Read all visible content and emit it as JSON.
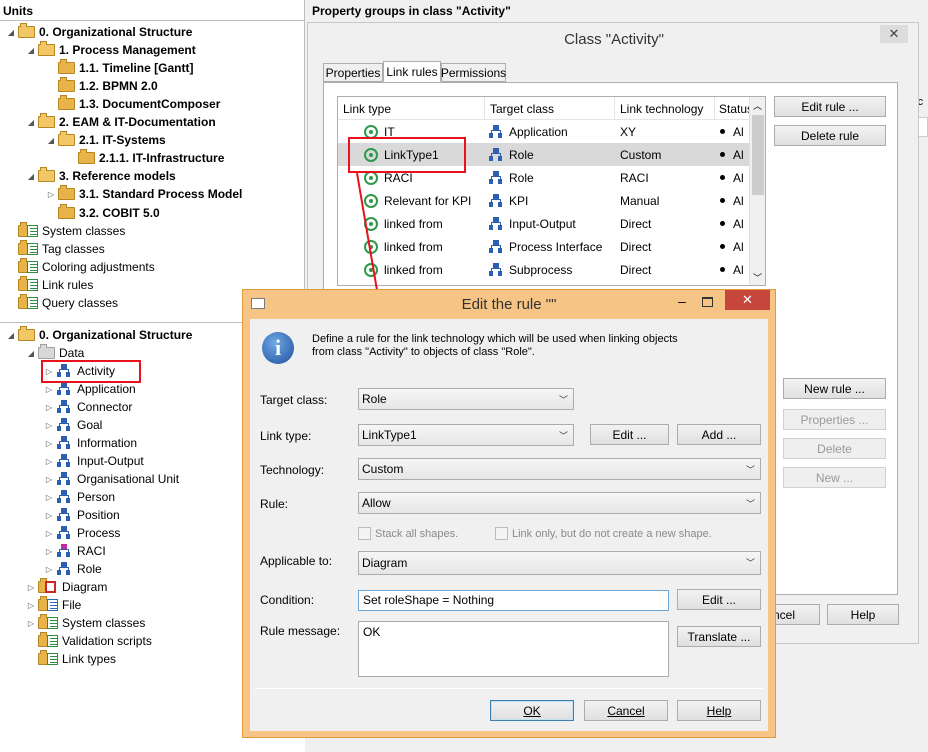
{
  "units_panel": {
    "title": "Units",
    "tree": [
      {
        "label": "0. Organizational Structure",
        "bold": true
      },
      {
        "label": "1. Process Management",
        "bold": true
      },
      {
        "label": "1.1. Timeline [Gantt]",
        "bold": true
      },
      {
        "label": "1.2. BPMN 2.0",
        "bold": true
      },
      {
        "label": "1.3. DocumentComposer",
        "bold": true
      },
      {
        "label": "2. EAM & IT-Documentation",
        "bold": true
      },
      {
        "label": "2.1. IT-Systems",
        "bold": true
      },
      {
        "label": "2.1.1. IT-Infrastructure",
        "bold": true
      },
      {
        "label": "3. Reference models",
        "bold": true
      },
      {
        "label": "3.1. Standard Process Model",
        "bold": true
      },
      {
        "label": "3.2. COBIT 5.0",
        "bold": true
      },
      {
        "label": "System classes"
      },
      {
        "label": "Tag classes"
      },
      {
        "label": "Coloring adjustments"
      },
      {
        "label": "Link rules"
      },
      {
        "label": "Query classes"
      }
    ]
  },
  "classes_panel": {
    "root": "0. Organizational Structure",
    "data": "Data",
    "classes": [
      "Activity",
      "Application",
      "Connector",
      "Goal",
      "Information",
      "Input-Output",
      "Organisational Unit",
      "Person",
      "Position",
      "Process",
      "RACI",
      "Role"
    ],
    "others": [
      "Diagram",
      "File",
      "System classes",
      "Validation scripts",
      "Link types"
    ]
  },
  "property_panel": {
    "title": "Property groups in class \"Activity\"",
    "right_partial": "atic"
  },
  "class_window": {
    "title": "Class \"Activity\"",
    "tabs": [
      "Properties",
      "Link rules",
      "Permissions"
    ],
    "columns": [
      "Link type",
      "Target class",
      "Link technology",
      "Status"
    ],
    "rows": [
      {
        "link_type": "IT",
        "target": "Application",
        "tech": "XY",
        "status": "Al"
      },
      {
        "link_type": "LinkType1",
        "target": "Role",
        "tech": "Custom",
        "status": "Al"
      },
      {
        "link_type": "RACI",
        "target": "Role",
        "tech": "RACI",
        "status": "Al"
      },
      {
        "link_type": "Relevant for KPI",
        "target": "KPI",
        "tech": "Manual",
        "status": "Al"
      },
      {
        "link_type": "linked from",
        "target": "Input-Output",
        "tech": "Direct",
        "status": "Al"
      },
      {
        "link_type": "linked from",
        "target": "Process Interface",
        "tech": "Direct",
        "status": "Al"
      },
      {
        "link_type": "linked from",
        "target": "Subprocess",
        "tech": "Direct",
        "status": "Al"
      }
    ],
    "buttons": {
      "edit_rule": "Edit rule ...",
      "delete_rule": "Delete rule",
      "new_rule": "New rule ...",
      "properties": "Properties ...",
      "delete": "Delete",
      "new": "New ...",
      "cancel": "ncel",
      "help": "Help"
    }
  },
  "dialog": {
    "title": "Edit the rule \"\"",
    "description_line1": "Define a rule for the link technology which will be used when linking objects",
    "description_line2": "from class \"Activity\" to objects of class \"Role\".",
    "labels": {
      "target_class": "Target class:",
      "link_type": "Link type:",
      "technology": "Technology:",
      "rule": "Rule:",
      "applicable_to": "Applicable to:",
      "condition": "Condition:",
      "rule_message": "Rule message:"
    },
    "values": {
      "target_class": "Role",
      "link_type": "LinkType1",
      "technology": "Custom",
      "rule": "Allow",
      "applicable_to": "Diagram",
      "condition": "Set roleShape = Nothing",
      "rule_message": "OK"
    },
    "checkboxes": {
      "stack": "Stack all shapes.",
      "link_only": "Link only, but do not create a new shape."
    },
    "buttons": {
      "edit1": "Edit ...",
      "add": "Add ...",
      "edit2": "Edit ...",
      "translate": "Translate ...",
      "ok": "OK",
      "cancel": "Cancel",
      "help": "Help"
    }
  },
  "colors": {
    "accent_red": "#e8121c",
    "selection": "#d9d9d9",
    "dialog_border": "#f2a14a"
  }
}
